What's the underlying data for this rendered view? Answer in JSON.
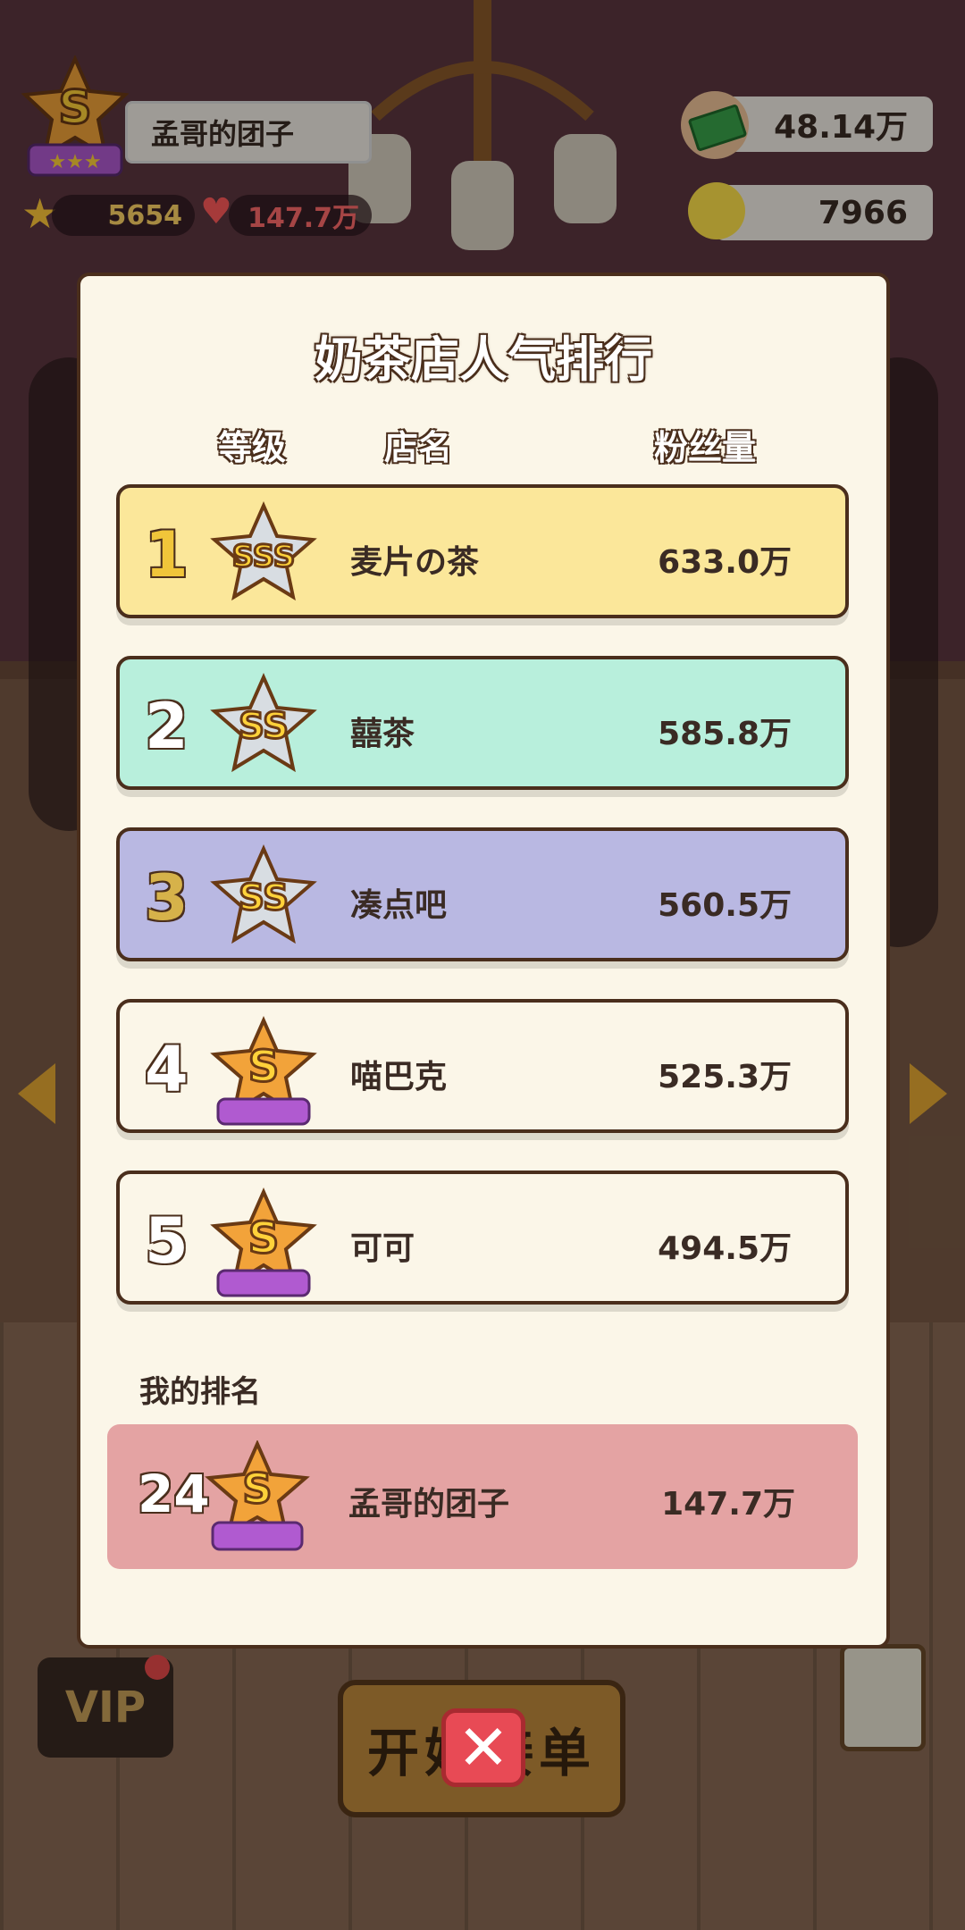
{
  "profile": {
    "name": "孟哥的团子",
    "stars": "5654",
    "fans": "147.7万",
    "level": "S"
  },
  "currency": {
    "money": "48.14万",
    "ideas": "7966"
  },
  "modal": {
    "title": "奶茶店人气排行",
    "col_level": "等级",
    "col_shop": "店名",
    "col_fans": "粉丝量",
    "my_rank_label": "我的排名",
    "close_label": "✕",
    "rows": [
      {
        "rank": "1",
        "level": "SSS",
        "shop": "麦片の茶",
        "fans": "633.0万",
        "bg": "#fbe79a",
        "rank_color": "#f0c53a"
      },
      {
        "rank": "2",
        "level": "SS",
        "shop": "囍茶",
        "fans": "585.8万",
        "bg": "#b8efdc",
        "rank_color": "#ffffff"
      },
      {
        "rank": "3",
        "level": "SS",
        "shop": "凑点吧",
        "fans": "560.5万",
        "bg": "#b9b8e2",
        "rank_color": "#d6b24a"
      },
      {
        "rank": "4",
        "level": "S",
        "shop": "喵巴克",
        "fans": "525.3万",
        "bg": "#fbf6e8",
        "rank_color": "#ffffff"
      },
      {
        "rank": "5",
        "level": "S",
        "shop": "可可",
        "fans": "494.5万",
        "bg": "#fbf6e8",
        "rank_color": "#ffffff"
      }
    ],
    "mine": {
      "rank": "24",
      "level": "S",
      "shop": "孟哥的团子",
      "fans": "147.7万"
    }
  },
  "bottom": {
    "vip_label": "VIP",
    "open_button": "开始接单"
  }
}
